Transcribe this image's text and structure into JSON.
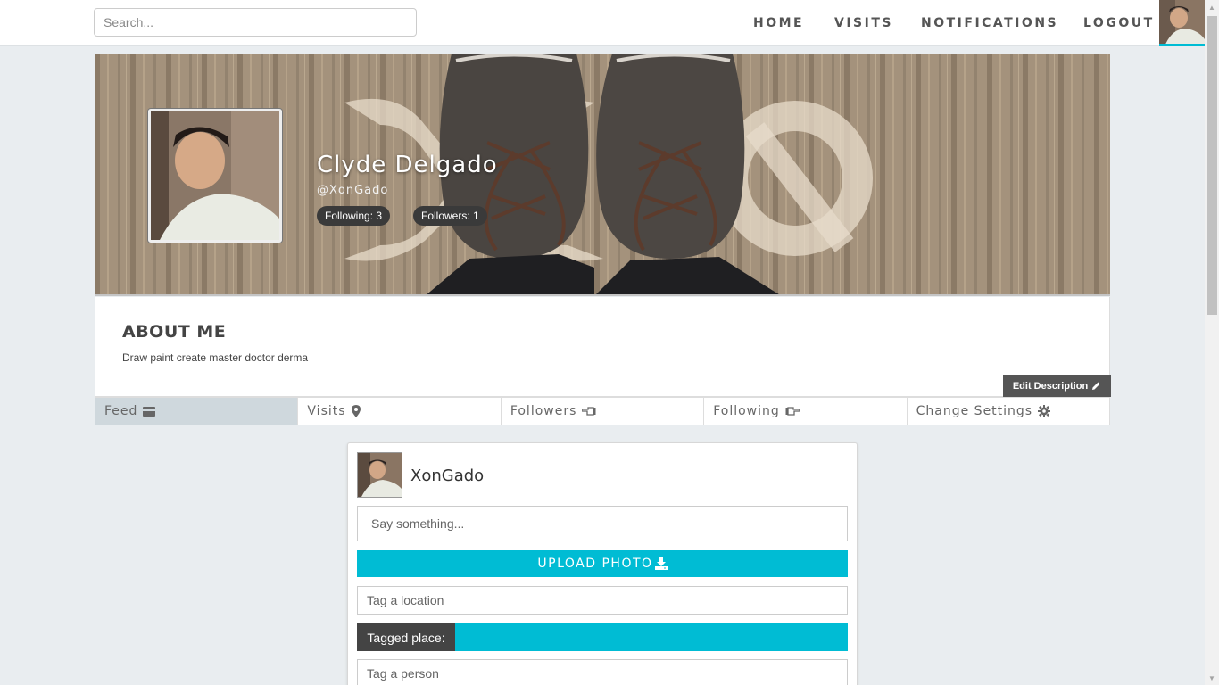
{
  "topbar": {
    "search_placeholder": "Search...",
    "nav": [
      "HOME",
      "VISITS",
      "NOTIFICATIONS",
      "LOGOUT"
    ]
  },
  "profile": {
    "name": "Clyde Delgado",
    "handle": "@XonGado",
    "following": "Following: 3",
    "followers": "Followers: 1"
  },
  "about": {
    "title": "ABOUT ME",
    "description": "Draw paint create master doctor derma",
    "edit_label": "Edit Description"
  },
  "tabs": [
    {
      "label": "Feed",
      "icon": "credit-card-icon"
    },
    {
      "label": "Visits",
      "icon": "map-marker-icon"
    },
    {
      "label": "Followers",
      "icon": "hand-pointing-left-icon"
    },
    {
      "label": "Following",
      "icon": "hand-pointing-right-icon"
    },
    {
      "label": "Change Settings",
      "icon": "gear-icon"
    }
  ],
  "composer": {
    "username": "XonGado",
    "say_placeholder": "Say something...",
    "upload_label": "UPLOAD PHOTO",
    "location_placeholder": "Tag a location",
    "tagged_label": "Tagged place:",
    "person_placeholder": "Tag a person"
  },
  "colors": {
    "accent": "#00bcd4",
    "dark": "#444444",
    "page_bg": "#e9edf0"
  }
}
